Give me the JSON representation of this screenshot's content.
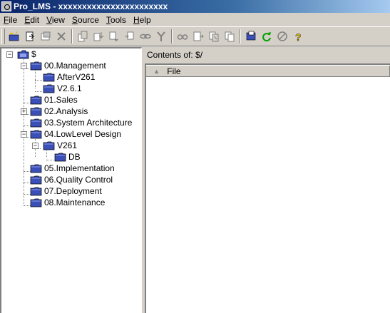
{
  "window": {
    "title": "Pro_LMS - xxxxxxxxxxxxxxxxxxxxxxx"
  },
  "menu": [
    {
      "label_pre": "",
      "accel": "F",
      "label_post": "ile"
    },
    {
      "label_pre": "",
      "accel": "E",
      "label_post": "dit"
    },
    {
      "label_pre": "",
      "accel": "V",
      "label_post": "iew"
    },
    {
      "label_pre": "",
      "accel": "S",
      "label_post": "ource"
    },
    {
      "label_pre": "",
      "accel": "T",
      "label_post": "ools"
    },
    {
      "label_pre": "",
      "accel": "H",
      "label_post": "elp"
    }
  ],
  "toolbar": {
    "icons": [
      "create-project-icon",
      "add-files-icon",
      "move-icon",
      "delete-icon",
      "check-out-icon",
      "check-in-icon",
      "undo-check-out-icon",
      "get-latest-icon",
      "share-icon",
      "branch-icon",
      "find-icon",
      "view-icon",
      "label-icon",
      "history-icon",
      "properties-icon",
      "refresh-icon",
      "cancel-icon",
      "help-icon"
    ]
  },
  "tree": {
    "root": "$",
    "items": [
      {
        "label": "00.Management"
      },
      {
        "label": "AfterV261"
      },
      {
        "label": "V2.6.1"
      },
      {
        "label": "01.Sales"
      },
      {
        "label": "02.Analysis"
      },
      {
        "label": "03.System Architecture"
      },
      {
        "label": "04.LowLevel Design"
      },
      {
        "label": "V261"
      },
      {
        "label": "DB"
      },
      {
        "label": "05.Implementation"
      },
      {
        "label": "06.Quality Control"
      },
      {
        "label": "07.Deployment"
      },
      {
        "label": "08.Maintenance"
      }
    ]
  },
  "contents": {
    "label": "Contents of: $/",
    "columns": [
      {
        "label": "File"
      }
    ]
  },
  "colors": {
    "folder": "#3a4fb8",
    "titlebar": "#0a246a",
    "refresh": "#00a000",
    "help": "#e0c000"
  }
}
